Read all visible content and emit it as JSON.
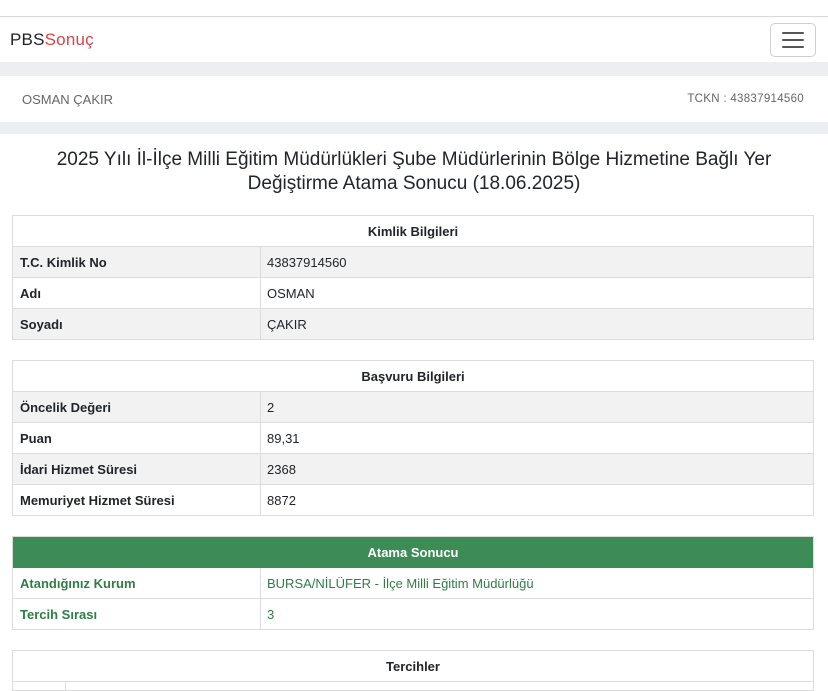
{
  "brand": {
    "part1": "PBS",
    "part2": "Sonuç"
  },
  "user": {
    "name": "OSMAN ÇAKIR",
    "tckn": "TCKN : 43837914560"
  },
  "title": "2025 Yılı İl-İlçe Milli Eğitim Müdürlükleri Şube Müdürlerinin Bölge Hizmetine Bağlı Yer Değiştirme Atama Sonucu (18.06.2025)",
  "kimlik": {
    "header": "Kimlik Bilgileri",
    "rows": [
      {
        "label": "T.C. Kimlik No",
        "value": "43837914560"
      },
      {
        "label": "Adı",
        "value": "OSMAN"
      },
      {
        "label": "Soyadı",
        "value": "ÇAKIR"
      }
    ]
  },
  "basvuru": {
    "header": "Başvuru Bilgileri",
    "rows": [
      {
        "label": "Öncelik Değeri",
        "value": "2"
      },
      {
        "label": "Puan",
        "value": "89,31"
      },
      {
        "label": "İdari Hizmet Süresi",
        "value": "2368"
      },
      {
        "label": "Memuriyet Hizmet Süresi",
        "value": "8872"
      }
    ]
  },
  "atama": {
    "header": "Atama Sonucu",
    "rows": [
      {
        "label": "Atandığınız Kurum",
        "value": "BURSA/NİLÜFER - İlçe Milli Eğitim Müdürlüğü"
      },
      {
        "label": "Tercih Sırası",
        "value": "3"
      }
    ]
  },
  "tercihler": {
    "header": "Tercihler"
  },
  "colors": {
    "accent_green": "#3d8b55",
    "brand_red": "#d9434a"
  }
}
